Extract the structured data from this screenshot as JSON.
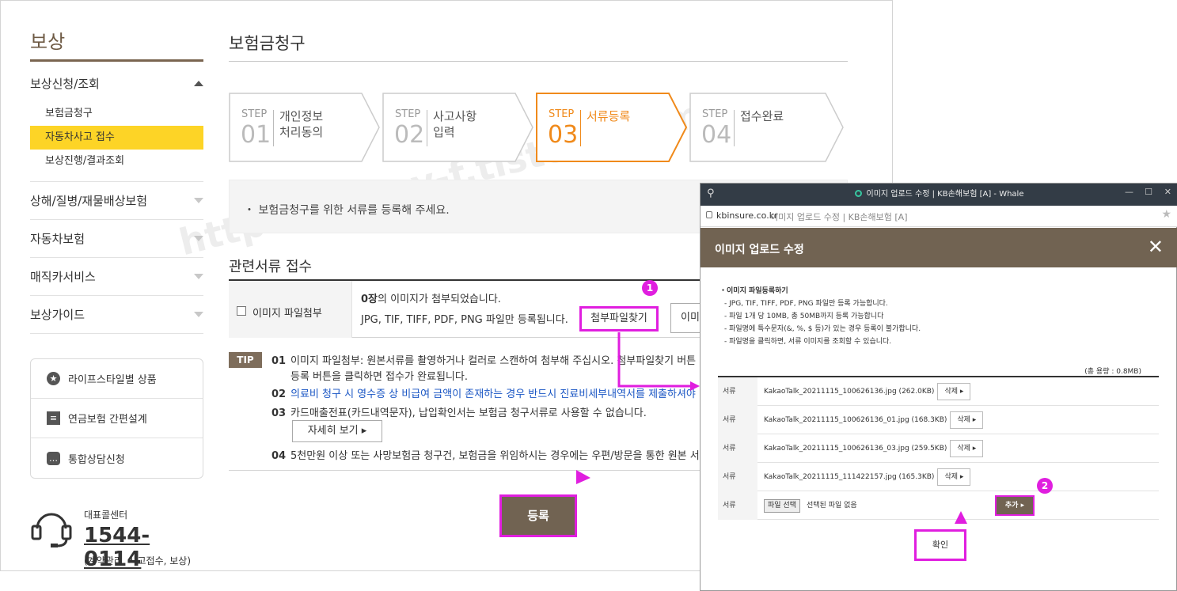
{
  "sidebar": {
    "title": "보상",
    "menu": [
      {
        "label": "보상신청/조회"
      },
      {
        "label": "상해/질병/재물배상보험"
      },
      {
        "label": "자동차보험"
      },
      {
        "label": "매직카서비스"
      },
      {
        "label": "보상가이드"
      }
    ],
    "submenu": [
      {
        "label": "보험금청구"
      },
      {
        "label": "자동차사고 접수"
      },
      {
        "label": "보상진행/결과조회"
      }
    ],
    "quick": [
      {
        "label": "라이프스타일별 상품",
        "icon": "star-icon"
      },
      {
        "label": "연금보험 간편설계",
        "icon": "document-icon"
      },
      {
        "label": "통합상담신청",
        "icon": "chat-icon"
      }
    ],
    "call": {
      "label": "대표콜센터",
      "number": "1544-0114",
      "sub": "(계약관리, 사고접수, 보상)"
    }
  },
  "main": {
    "title": "보험금청구",
    "steps": [
      {
        "label": "STEP",
        "num": "01",
        "line1": "개인정보",
        "line2": "처리동의"
      },
      {
        "label": "STEP",
        "num": "02",
        "line1": "사고사항",
        "line2": "입력"
      },
      {
        "label": "STEP",
        "num": "03",
        "line1": "서류등록",
        "line2": ""
      },
      {
        "label": "STEP",
        "num": "04",
        "line1": "접수완료",
        "line2": ""
      }
    ],
    "notice": "・ 보험금청구를 위한 서류를 등록해 주세요.",
    "section_title": "관련서류 접수",
    "attach": {
      "label": "이미지 파일첨부",
      "info_count": "0장",
      "info_rest": "의 이미지가 첨부되었습니다.",
      "info2": "JPG, TIF, TIFF, PDF, PNG 파일만 등록됩니다.",
      "find_button": "첨부파일찾기",
      "img_button": "이미"
    },
    "tips_badge": "TIP",
    "tips": [
      {
        "num": "01",
        "text": "이미지 파일첨부: 원본서류를 촬영하거나 컬러로 스캔하여 첨부해 주십시오. 첨부파일찾기 버튼",
        "cont": "등록 버튼을 클릭하면 접수가 완료됩니다."
      },
      {
        "num": "02",
        "text": "의료비 청구 시 영수증 상 비급여 금액이 존재하는 경우 반드시 진료비세부내역서를 제출하셔야"
      },
      {
        "num": "03",
        "text": "카드매출전표(카드내역문자), 납입확인서는 보험금 청구서류로 사용할 수 없습니다."
      },
      {
        "num": "04",
        "text": "5천만원 이상 또는 사망보험금 청구건, 보험금을 위임하시는 경우에는 우편/방문을 통한 원본 서"
      }
    ],
    "detail_button": "자세히 보기 ▸",
    "register_button": "등록",
    "watermark": "https://jenny-f.tistory.com"
  },
  "popup": {
    "window_title": "이미지 업로드 수정 | KB손해보험 [A] - Whale",
    "domain": "kbinsure.co.kr",
    "page_title": "이미지 업로드 수정 | KB손해보험 [A]",
    "header": "이미지 업로드 수정",
    "guide_title": "이미지 파일등록하기",
    "guide": [
      "- JPG, TIF, TIFF, PDF, PNG 파일만 등록 가능합니다.",
      "- 파일 1개 당 10MB, 총 50MB까지 등록 가능합니다",
      "- 파일명에 특수문자(&, %, $ 등)가 있는 경우 등록이 불가합니다.",
      "- 파일명을 클릭하면, 서류 이미지를 조회할 수 있습니다."
    ],
    "total": "(총 용량 : 0.8MB)",
    "rows": [
      {
        "th": "서류",
        "file": "KakaoTalk_20211115_100626136.jpg (262.0KB)",
        "del": "삭제 ▸"
      },
      {
        "th": "서류",
        "file": "KakaoTalk_20211115_100626136_01.jpg (168.3KB)",
        "del": "삭제 ▸"
      },
      {
        "th": "서류",
        "file": "KakaoTalk_20211115_100626136_03.jpg (259.5KB)",
        "del": "삭제 ▸"
      },
      {
        "th": "서류",
        "file": "KakaoTalk_20211115_111422157.jpg (165.3KB)",
        "del": "삭제 ▸"
      }
    ],
    "upload_row": {
      "th": "서류",
      "file_button": "파일 선택",
      "no_file": "선택된 파일 없음",
      "add_button": "추가 ▸"
    },
    "ok_button": "확인"
  },
  "annotations": {
    "badge1": "1",
    "badge2": "2",
    "highlight_color": "#e01edf"
  },
  "colors": {
    "brand_brown": "#716352",
    "active_yellow": "#fdd426",
    "step_orange": "#f08a1b"
  }
}
